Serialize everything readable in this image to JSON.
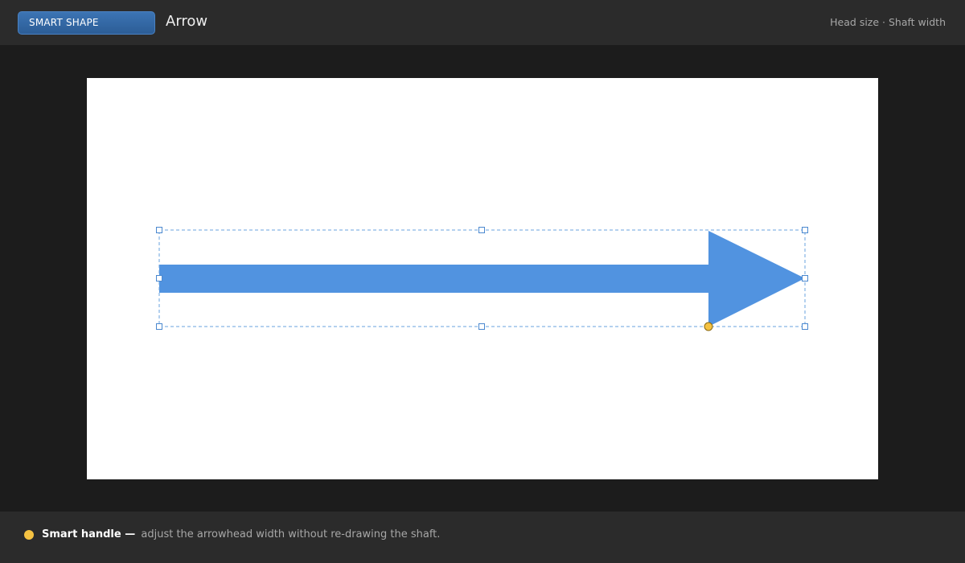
{
  "header": {
    "badge": "SMART SHAPE",
    "shape_name": "Arrow",
    "properties": "Head size · Shaft width"
  },
  "canvas": {
    "background": "#ffffff",
    "shape": {
      "type": "arrow",
      "fill": "#5193e0",
      "selection_color": "#5193e0",
      "smart_handle_color": "#f5c242"
    }
  },
  "footer": {
    "label": "Smart handle —",
    "description": "adjust the arrowhead width without re-drawing the shaft."
  }
}
